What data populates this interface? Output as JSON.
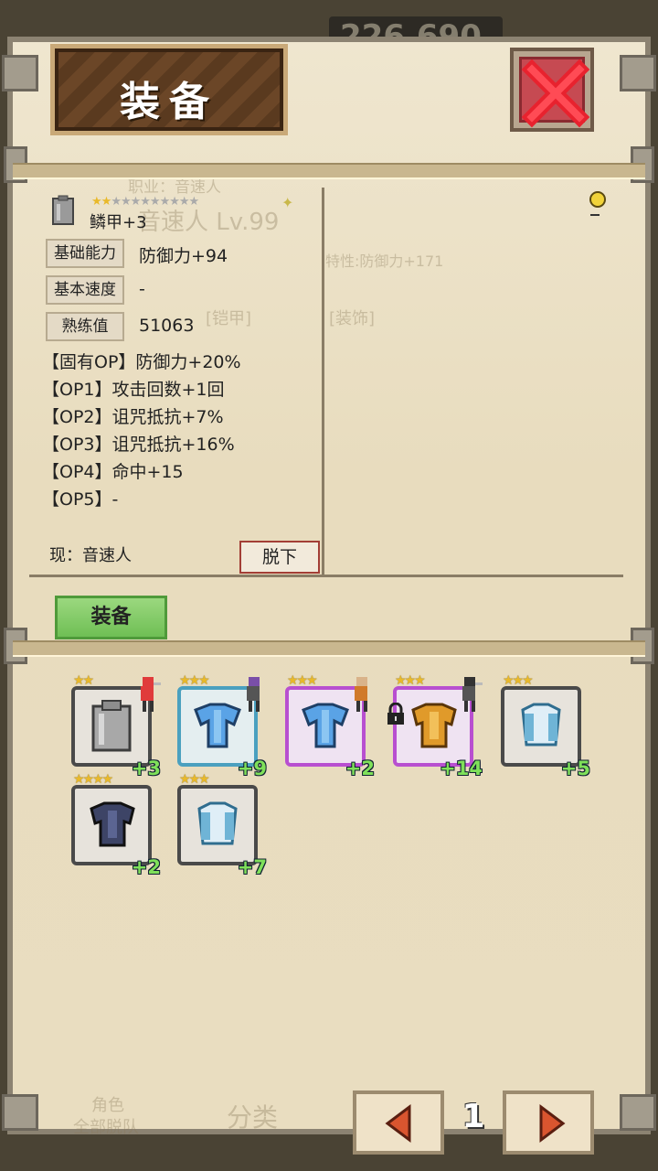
{
  "header": {
    "title": "装备",
    "gold": "226,690"
  },
  "detail": {
    "item_name": "鳞甲+3",
    "rows": [
      {
        "label": "基础能力",
        "value": "防御力+94"
      },
      {
        "label": "基本速度",
        "value": "-"
      },
      {
        "label": "熟练值",
        "value": "51063"
      }
    ],
    "options": [
      "【固有OP】防御力+20%",
      "【OP1】攻击回数+1回",
      "【OP2】诅咒抵抗+7%",
      "【OP3】诅咒抵抗+16%",
      "【OP4】命中+15",
      "【OP5】-"
    ],
    "current": "现：音速人",
    "unequip_label": "脱下"
  },
  "equip_label": "装备",
  "items": [
    {
      "stars": "★★",
      "plus": "+3",
      "icon": "gray-armor-icon",
      "frame": "normal"
    },
    {
      "stars": "★★★",
      "plus": "+9",
      "icon": "blue-robe-icon",
      "frame": "blue"
    },
    {
      "stars": "★★★",
      "plus": "+2",
      "icon": "blue-robe-icon",
      "frame": "purple"
    },
    {
      "stars": "★★★",
      "plus": "+14",
      "icon": "gold-armor-icon",
      "frame": "purple"
    },
    {
      "stars": "★★★",
      "plus": "+5",
      "icon": "white-robe-icon",
      "frame": "normal"
    },
    {
      "stars": "★★★★",
      "plus": "+2",
      "icon": "dark-armor-icon",
      "frame": "normal"
    },
    {
      "stars": "★★★",
      "plus": "+7",
      "icon": "white-robe-icon",
      "frame": "normal"
    }
  ],
  "pager": {
    "page": "1"
  },
  "background": {
    "job": "职业：音速人",
    "hero": "音速人 Lv.99",
    "trait": "特性:防御力+171",
    "armor_tab": "[铠甲]",
    "accessory_tab": "[装饰]",
    "role": "角色",
    "all_leave": "全部脱队",
    "category": "分类"
  },
  "colors": {
    "accent_green": "#7fe05a",
    "close_red": "#c64a52",
    "star_gold": "#e9b92a"
  }
}
